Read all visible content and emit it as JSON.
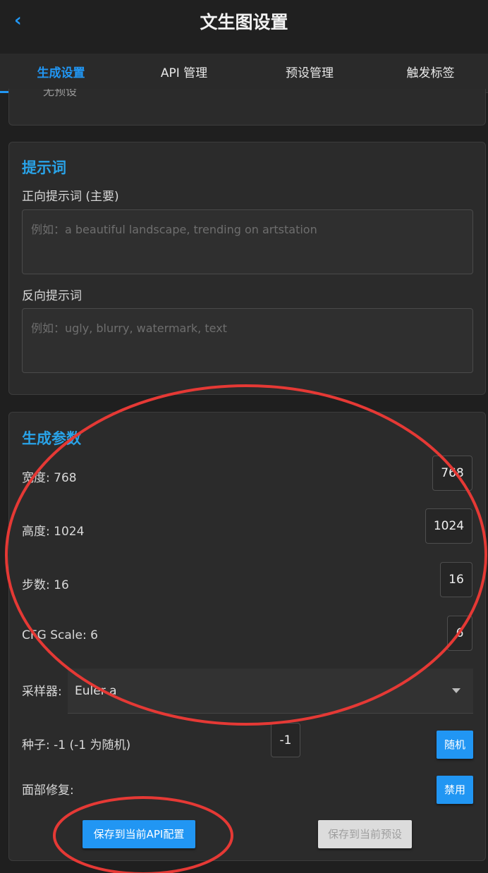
{
  "header": {
    "back_icon": "chevron-left-icon",
    "back_glyph": "‹",
    "title": "文生图设置"
  },
  "tabs": [
    {
      "label": "生成设置",
      "active": true
    },
    {
      "label": "API 管理",
      "active": false
    },
    {
      "label": "预设管理",
      "active": false
    },
    {
      "label": "触发标签",
      "active": false
    }
  ],
  "previous_card": {
    "peek_text": "无预设"
  },
  "prompts": {
    "title": "提示词",
    "positive_label": "正向提示词 (主要)",
    "positive_placeholder": "例如：a beautiful landscape, trending on artstation",
    "negative_label": "反向提示词",
    "negative_placeholder": "例如：ugly, blurry, watermark, text"
  },
  "params": {
    "title": "生成参数",
    "width": {
      "label": "宽度: 768",
      "value": "768"
    },
    "height": {
      "label": "高度: 1024",
      "value": "1024"
    },
    "steps": {
      "label": "步数: 16",
      "value": "16"
    },
    "cfg": {
      "label": "CFG Scale: 6",
      "value": "6"
    },
    "sampler": {
      "label": "采样器:",
      "value": "Euler a"
    },
    "seed": {
      "label": "种子: -1 (-1 为随机)",
      "value": "-1",
      "random_button": "随机"
    },
    "face_restore": {
      "label": "面部修复:",
      "button": "禁用"
    },
    "save_api_button": "保存到当前API配置",
    "save_preset_button": "保存到当前预设"
  },
  "colors": {
    "accent": "#2196f3",
    "section_title": "#29a3e8",
    "annotation": "#e53935"
  }
}
